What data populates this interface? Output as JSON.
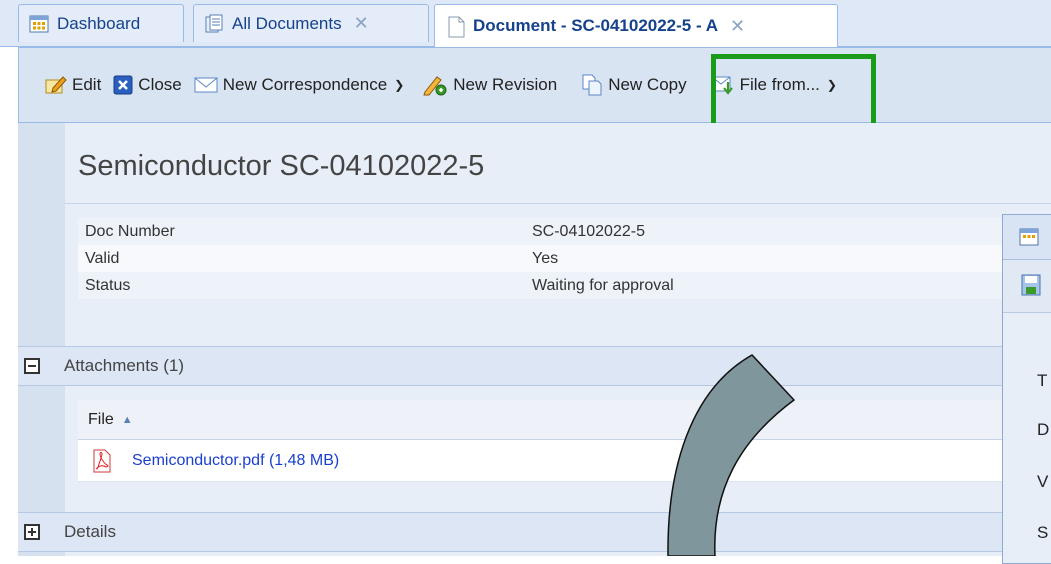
{
  "tabs": [
    {
      "label": "Dashboard",
      "icon": "dashboard-icon",
      "closable": false,
      "active": false
    },
    {
      "label": "All Documents",
      "icon": "documents-icon",
      "closable": true,
      "active": false
    },
    {
      "label": "Document - SC-04102022-5 - A",
      "icon": "document-icon",
      "closable": true,
      "active": true
    }
  ],
  "toolbar": {
    "edit": "Edit",
    "close": "Close",
    "new_correspondence": "New Correspondence",
    "new_revision": "New Revision",
    "new_copy": "New Copy",
    "file_from": "File from..."
  },
  "document": {
    "title": "Semiconductor SC-04102022-5",
    "properties": [
      {
        "key": "Doc Number",
        "value": "SC-04102022-5"
      },
      {
        "key": "Valid",
        "value": "Yes"
      },
      {
        "key": "Status",
        "value": "Waiting for approval"
      }
    ]
  },
  "attachments": {
    "header": "Attachments (1)",
    "column_file": "File",
    "files": [
      {
        "name": "Semiconductor.pdf (1,48 MB)",
        "icon": "pdf-icon"
      }
    ]
  },
  "details": {
    "header": "Details"
  },
  "right_window": {
    "letters": [
      "T",
      "D",
      "V",
      "S"
    ]
  },
  "colors": {
    "highlight": "#1a9c1a",
    "link": "#1a3fcf",
    "tab_text": "#15428b",
    "arc": "#7f969c"
  }
}
